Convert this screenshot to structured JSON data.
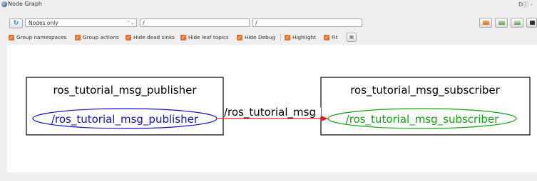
{
  "window": {
    "title": "Node Graph",
    "controls": "Dⓘ -"
  },
  "toolbar": {
    "refresh_icon": "refresh-icon",
    "display_mode": "Nodes only",
    "display_arrows": "⌃⌄",
    "node_filter": "/",
    "topic_filter": "/"
  },
  "options": {
    "group_namespaces": "Group namespaces",
    "group_actions": "Group actions",
    "hide_dead_sinks": "Hide dead sinks",
    "hide_leaf_topics": "Hide leaf topics",
    "hide_debug": "Hide Debug",
    "highlight": "Highlight",
    "fit": "Fit"
  },
  "graph": {
    "publisher_box": "ros_tutorial_msg_publisher",
    "publisher_node": "/ros_tutorial_msg_publisher",
    "topic": "/ros_tutorial_msg",
    "subscriber_box": "ros_tutorial_msg_subscriber",
    "subscriber_node": "/ros_tutorial_msg_subscriber"
  },
  "colors": {
    "checkbox": "#e8702a",
    "publisher_node": "#1010c0",
    "subscriber_node": "#11a011",
    "edge": "#e02020"
  }
}
